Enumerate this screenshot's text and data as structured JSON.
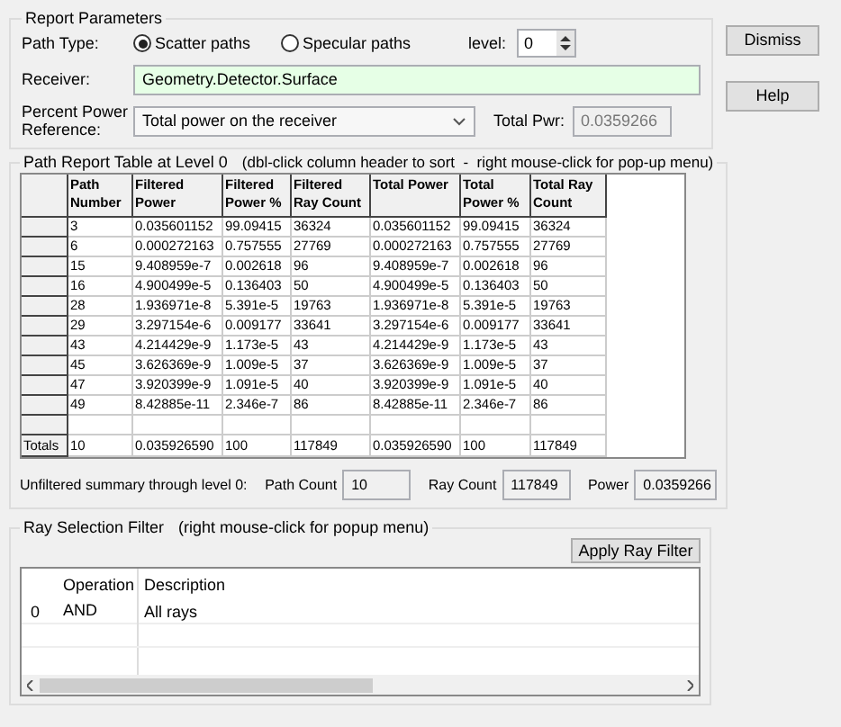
{
  "report_parameters": {
    "title": "Report Parameters",
    "path_type_label": "Path Type:",
    "path_types": [
      {
        "label": "Scatter paths",
        "selected": true
      },
      {
        "label": "Specular paths",
        "selected": false
      }
    ],
    "level_label": "level:",
    "level_value": "0",
    "receiver_label": "Receiver:",
    "receiver_value": "Geometry.Detector.Surface",
    "reference_label": "Percent Power Reference:",
    "reference_value": "Total power on the receiver",
    "total_pwr_label": "Total Pwr:",
    "total_pwr_value": "0.0359266"
  },
  "buttons": [
    "Dismiss",
    "Help"
  ],
  "path_table": {
    "title": "Path Report Table at Level 0",
    "hint": "(dbl-click column header to sort  -  right mouse-click for pop-up menu)",
    "columns": [
      "Path Number",
      "Filtered Power",
      "Filtered Power %",
      "Filtered Ray Count",
      "Total Power",
      "Total Power %",
      "Total Ray Count"
    ],
    "rows": [
      [
        "3",
        "0.035601152",
        "99.09415",
        "36324",
        "0.035601152",
        "99.09415",
        "36324"
      ],
      [
        "6",
        "0.000272163",
        "0.757555",
        "27769",
        "0.000272163",
        "0.757555",
        "27769"
      ],
      [
        "15",
        "9.408959e-7",
        "0.002618",
        "96",
        "9.408959e-7",
        "0.002618",
        "96"
      ],
      [
        "16",
        "4.900499e-5",
        "0.136403",
        "50",
        "4.900499e-5",
        "0.136403",
        "50"
      ],
      [
        "28",
        "1.936971e-8",
        "5.391e-5",
        "19763",
        "1.936971e-8",
        "5.391e-5",
        "19763"
      ],
      [
        "29",
        "3.297154e-6",
        "0.009177",
        "33641",
        "3.297154e-6",
        "0.009177",
        "33641"
      ],
      [
        "43",
        "4.214429e-9",
        "1.173e-5",
        "43",
        "4.214429e-9",
        "1.173e-5",
        "43"
      ],
      [
        "45",
        "3.626369e-9",
        "1.009e-5",
        "37",
        "3.626369e-9",
        "1.009e-5",
        "37"
      ],
      [
        "47",
        "3.920399e-9",
        "1.091e-5",
        "40",
        "3.920399e-9",
        "1.091e-5",
        "40"
      ],
      [
        "49",
        "8.42885e-11",
        "2.346e-7",
        "86",
        "8.42885e-11",
        "2.346e-7",
        "86"
      ]
    ],
    "totals_label": "Totals",
    "totals": [
      "10",
      "0.035926590",
      "100",
      "117849",
      "0.035926590",
      "100",
      "117849"
    ]
  },
  "summary": {
    "label": "Unfiltered summary through level 0:",
    "fields": [
      {
        "label": "Path Count",
        "value": "10"
      },
      {
        "label": "Ray Count",
        "value": "117849"
      },
      {
        "label": "Power",
        "value": "0.0359266"
      }
    ]
  },
  "ray_filter": {
    "title": "Ray Selection Filter",
    "hint": "(right mouse-click for popup menu)",
    "apply_button": "Apply Ray Filter",
    "columns": [
      "Operation",
      "Description"
    ],
    "rows": [
      {
        "index": "0",
        "operation": "AND",
        "description": "All rays"
      }
    ]
  }
}
